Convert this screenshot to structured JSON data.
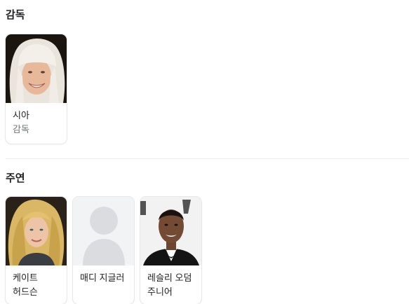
{
  "director_section": {
    "title": "감독",
    "people": [
      {
        "name": "시아",
        "role": "감독",
        "photo_icon": "person-photo"
      }
    ]
  },
  "cast_section": {
    "title": "주연",
    "people": [
      {
        "name": "케이트 허드슨",
        "photo_icon": "person-photo"
      },
      {
        "name": "매디 지글러",
        "photo_icon": "placeholder-avatar-icon"
      },
      {
        "name": "레슬리 오덤 주니어",
        "photo_icon": "person-photo"
      }
    ]
  },
  "colors": {
    "text_primary": "#202124",
    "text_secondary": "#70757a",
    "placeholder_bg": "#f1f3f4",
    "placeholder_silhouette": "#dadce0"
  }
}
